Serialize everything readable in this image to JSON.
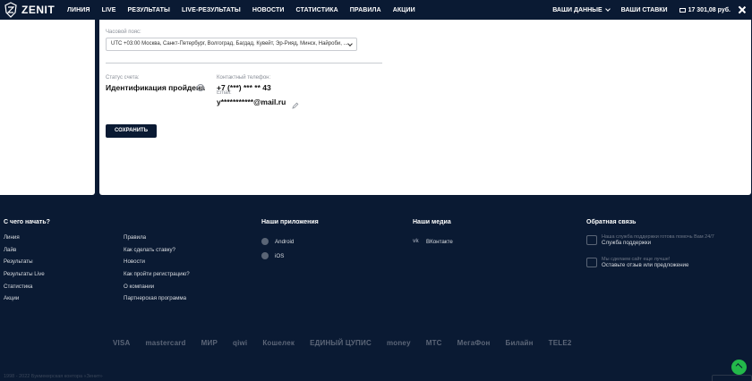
{
  "brand": {
    "name": "ZENIT"
  },
  "nav": {
    "items": [
      "ЛИНИЯ",
      "LIVE",
      "РЕЗУЛЬТАТЫ",
      "LIVE-РЕЗУЛЬТАТЫ",
      "НОВОСТИ",
      "СТАТИСТИКА",
      "ПРАВИЛА",
      "АКЦИИ"
    ],
    "your_data": "ВАШИ ДАННЫЕ",
    "your_bets": "ВАШИ СТАВКИ",
    "balance": "17 301,08 руб."
  },
  "profile": {
    "timezone_label": "Часовой пояс:",
    "timezone_value": "UTC +03:00 Москва, Санкт-Петербург, Волгоград, Багдад, Кувейт, Эр-Рияд, Минск, Найроби, ...",
    "status_label": "Статус счета:",
    "status_value": "Идентификация пройдена",
    "phone_label": "Контактный телефон:",
    "phone_value": "+7 (***) *** ** 43",
    "email_label": "Email:",
    "email_value": "y***********@mail.ru",
    "save_label": "СОХРАНИТЬ"
  },
  "footer": {
    "start": {
      "title": "С чего начать?",
      "items": [
        "Линия",
        "Лайв",
        "Результаты",
        "Результаты Live",
        "Статистика",
        "Акции"
      ]
    },
    "info": {
      "items": [
        "Правила",
        "Как сделать ставку?",
        "Новости",
        "Как пройти регистрацию?",
        "О компании",
        "Партнерская программа"
      ]
    },
    "apps": {
      "title": "Наши приложения",
      "items": [
        "Android",
        "iOS"
      ]
    },
    "media": {
      "title": "Наши медиа",
      "items": [
        "ВКонтакте"
      ]
    },
    "feedback": {
      "title": "Обратная связь",
      "support_small": "Наша служба поддержки готова помочь Вам 24/7",
      "support_main": "Служба поддержки",
      "review_small": "Мы сделаем сайт еще лучше!",
      "review_main": "Оставьте отзыв или предложение"
    },
    "payments": [
      "VISA",
      "mastercard",
      "МИР",
      "qiwi",
      "Кошелек",
      "ЕДИНЫЙ ЦУПИС",
      "money",
      "МТС",
      "МегаФон",
      "Билайн",
      "TELE2"
    ],
    "copyright": "1998 - 2022 Букмекерская контора «Зенит»"
  }
}
